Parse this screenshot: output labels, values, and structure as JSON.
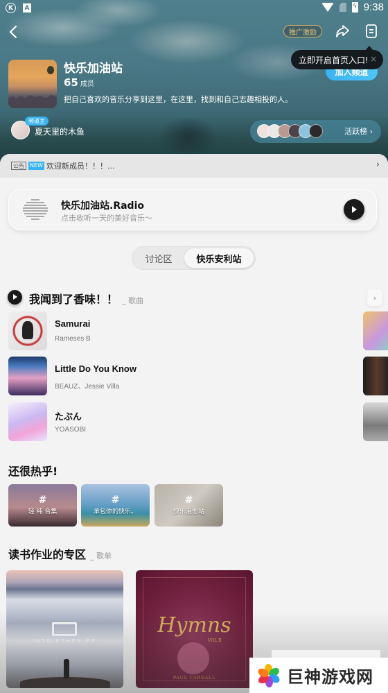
{
  "status_bar": {
    "left_icons": [
      "k-app-icon",
      "a-app-icon"
    ],
    "time": "9:38",
    "right_icons": [
      "wifi-icon",
      "no-sim-icon",
      "battery-charging-icon"
    ]
  },
  "top_nav": {
    "back_icon": "back-chevron-icon",
    "promo_label": "推广激励",
    "share_icon": "share-icon",
    "menu_icon": "document-menu-icon"
  },
  "tooltip": {
    "text": "立即开启首页入口!",
    "close": "×"
  },
  "channel": {
    "name": "快乐加油站",
    "member_count": "65",
    "member_label": "成员",
    "description": "把自己喜欢的音乐分享到这里，在这里，找到和自己志趣相投的人。",
    "join_label": "加入频道",
    "owner_badge": "频道主",
    "owner_name": "夏天里的木鱼",
    "rank_label": "活跃榜 ›",
    "rank_avatar_colors": [
      "#efe2dc",
      "#e8e8e6",
      "#b99a92",
      "#4c4448",
      "#8cc4e0",
      "#2a2a2a"
    ]
  },
  "notice": {
    "tag": "公告",
    "new_badge": "NEW",
    "text": "欢迎新成员！！！...",
    "chevron": "›"
  },
  "radio": {
    "title": "快乐加油站.Radio",
    "subtitle": "点击收听一天的美好音乐～"
  },
  "tabs": [
    {
      "label": "讨论区",
      "active": false
    },
    {
      "label": "快乐安利站",
      "active": true
    }
  ],
  "songs_section": {
    "title": "我闻到了香味！！",
    "subtitle": "_ 歌曲",
    "more": "›",
    "songs": [
      {
        "name": "Samurai",
        "artist": "Rameses B"
      },
      {
        "name": "Little Do You Know",
        "artist": "BEAUZ、Jessie Villa"
      },
      {
        "name": "たぶん",
        "artist": "YOASOBI"
      }
    ]
  },
  "hot_section": {
    "title": "还很热乎!",
    "topics": [
      {
        "hash": "#",
        "label": "轻 纯 合集"
      },
      {
        "hash": "#",
        "label": "承包你的快乐。"
      },
      {
        "hash": "#",
        "label": "快乐治愈站"
      }
    ]
  },
  "playlist_section": {
    "title": "读书作业的专区",
    "subtitle": "_ 歌单",
    "playlists": [
      {
        "cover_text": "INTO ETHER EP"
      },
      {
        "cover_title": "Hymns",
        "cover_vol": "VOL.II",
        "cover_artist": "PAUL CARDALL"
      }
    ]
  },
  "watermark": {
    "text": "巨神游戏网"
  }
}
